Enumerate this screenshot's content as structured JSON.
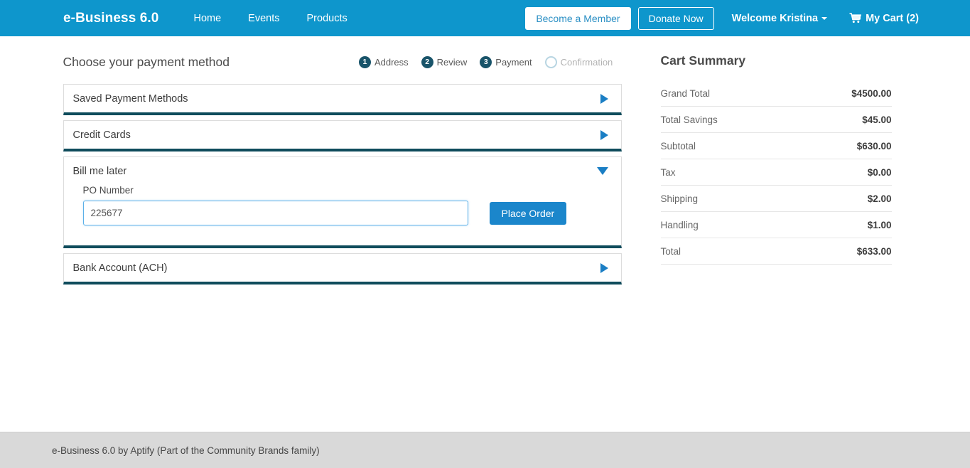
{
  "header": {
    "brand": "e-Business 6.0",
    "nav": [
      {
        "label": "Home"
      },
      {
        "label": "Events"
      },
      {
        "label": "Products"
      }
    ],
    "become_member_label": "Become a Member",
    "donate_label": "Donate Now",
    "welcome_label": "Welcome Kristina",
    "cart_label": "My Cart (2)",
    "background_color": "#0e96cc"
  },
  "main": {
    "page_title": "Choose your payment method",
    "steps": [
      {
        "num": "1",
        "label": "Address",
        "state": "active"
      },
      {
        "num": "2",
        "label": "Review",
        "state": "active"
      },
      {
        "num": "3",
        "label": "Payment",
        "state": "active"
      },
      {
        "num": "",
        "label": "Confirmation",
        "state": "inactive"
      }
    ],
    "panels": [
      {
        "title": "Saved Payment Methods",
        "expanded": false
      },
      {
        "title": "Credit Cards",
        "expanded": false
      },
      {
        "title": "Bill me later",
        "expanded": true
      },
      {
        "title": "Bank Account (ACH)",
        "expanded": false
      }
    ],
    "bill_me_later": {
      "po_label": "PO Number",
      "po_value": "225677",
      "po_placeholder": "",
      "place_order_label": "Place Order"
    },
    "accent_color": "#1a7ec4",
    "panel_underline_color": "#0f4c5c"
  },
  "cart_summary": {
    "title": "Cart Summary",
    "rows": [
      {
        "key": "Grand Total",
        "value": "$4500.00"
      },
      {
        "key": "Total Savings",
        "value": "$45.00"
      },
      {
        "key": "Subtotal",
        "value": "$630.00"
      },
      {
        "key": "Tax",
        "value": "$0.00"
      },
      {
        "key": "Shipping",
        "value": "$2.00"
      },
      {
        "key": "Handling",
        "value": "$1.00"
      },
      {
        "key": "Total",
        "value": "$633.00"
      }
    ]
  },
  "footer": {
    "text": "e-Business 6.0 by Aptify (Part of the Community Brands family)"
  }
}
